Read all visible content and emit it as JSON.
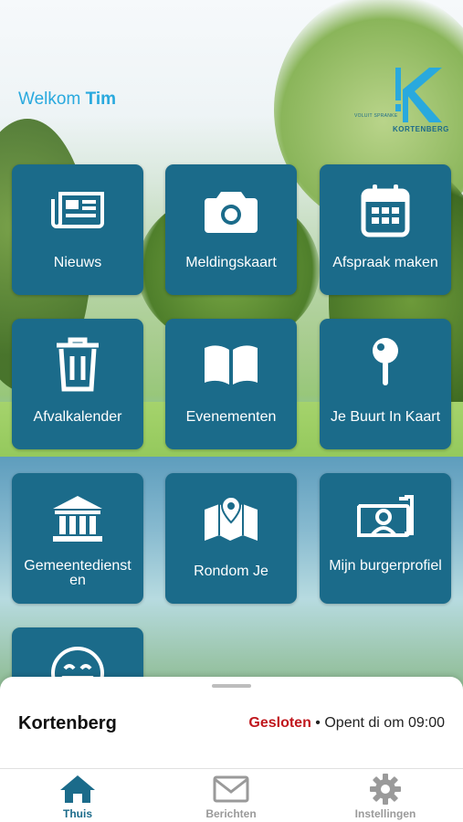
{
  "header": {
    "greeting": "Welkom",
    "user_name": "Tim",
    "logo_sub": "VOLUIT SPRANKE",
    "logo_name": "KORTENBERG"
  },
  "tiles": [
    {
      "label": "Nieuws",
      "icon": "newspaper-icon"
    },
    {
      "label": "Meldingskaart",
      "icon": "camera-icon"
    },
    {
      "label": "Afspraak maken",
      "icon": "calendar-icon"
    },
    {
      "label": "Afvalkalender",
      "icon": "trash-icon"
    },
    {
      "label": "Evenementen",
      "icon": "book-icon"
    },
    {
      "label": "Je Buurt In Kaart",
      "icon": "map-pin-icon"
    },
    {
      "label": "Gemeentedienst en",
      "icon": "building-icon"
    },
    {
      "label": "Rondom Je",
      "icon": "map-icon"
    },
    {
      "label": "Mijn burgerprofiel",
      "icon": "profile-card-icon"
    },
    {
      "label": "",
      "icon": "smiley-icon"
    }
  ],
  "info_sheet": {
    "place": "Kortenberg",
    "status": "Gesloten",
    "separator": "•",
    "opening": "Opent di om 09:00"
  },
  "tabbar": {
    "tabs": [
      {
        "label": "Thuis",
        "icon": "home-icon",
        "active": true
      },
      {
        "label": "Berichten",
        "icon": "envelope-icon",
        "active": false
      },
      {
        "label": "Instellingen",
        "icon": "gear-icon",
        "active": false
      }
    ]
  },
  "colors": {
    "tile": "#1b6b8a",
    "accent": "#29a9de",
    "closed": "#c0181e"
  }
}
